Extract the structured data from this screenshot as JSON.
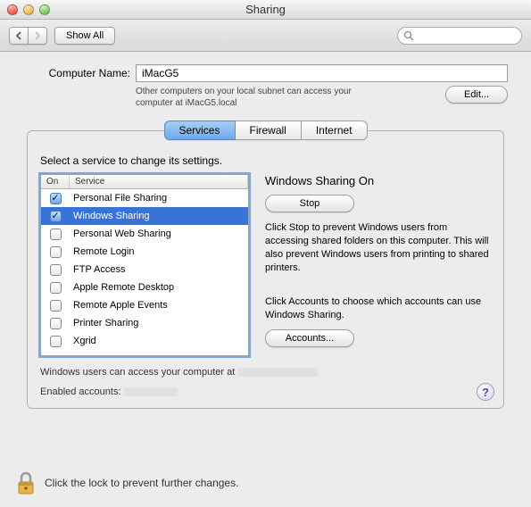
{
  "window": {
    "title": "Sharing"
  },
  "toolbar": {
    "show_all": "Show All",
    "search_placeholder": ""
  },
  "computer_name": {
    "label": "Computer Name:",
    "value": "iMacG5",
    "subtext": "Other computers on your local subnet can access your computer at iMacG5.local",
    "edit_label": "Edit..."
  },
  "tabs": {
    "services": "Services",
    "firewall": "Firewall",
    "internet": "Internet",
    "selected": "services"
  },
  "panel": {
    "instruction": "Select a service to change its settings.",
    "columns": {
      "on": "On",
      "service": "Service"
    },
    "services": [
      {
        "label": "Personal File Sharing",
        "checked": true,
        "selected": false
      },
      {
        "label": "Windows Sharing",
        "checked": true,
        "selected": true
      },
      {
        "label": "Personal Web Sharing",
        "checked": false,
        "selected": false
      },
      {
        "label": "Remote Login",
        "checked": false,
        "selected": false
      },
      {
        "label": "FTP Access",
        "checked": false,
        "selected": false
      },
      {
        "label": "Apple Remote Desktop",
        "checked": false,
        "selected": false
      },
      {
        "label": "Remote Apple Events",
        "checked": false,
        "selected": false
      },
      {
        "label": "Printer Sharing",
        "checked": false,
        "selected": false
      },
      {
        "label": "Xgrid",
        "checked": false,
        "selected": false
      }
    ],
    "detail": {
      "title": "Windows Sharing On",
      "stop_label": "Stop",
      "desc1": "Click Stop to prevent Windows users from accessing shared folders on this computer. This will also prevent Windows users from printing to shared printers.",
      "desc2": "Click Accounts to choose which accounts can use Windows Sharing.",
      "accounts_label": "Accounts..."
    },
    "footer1": "Windows users can access your computer at",
    "footer2": "Enabled accounts:"
  },
  "lock_text": "Click the lock to prevent further changes."
}
